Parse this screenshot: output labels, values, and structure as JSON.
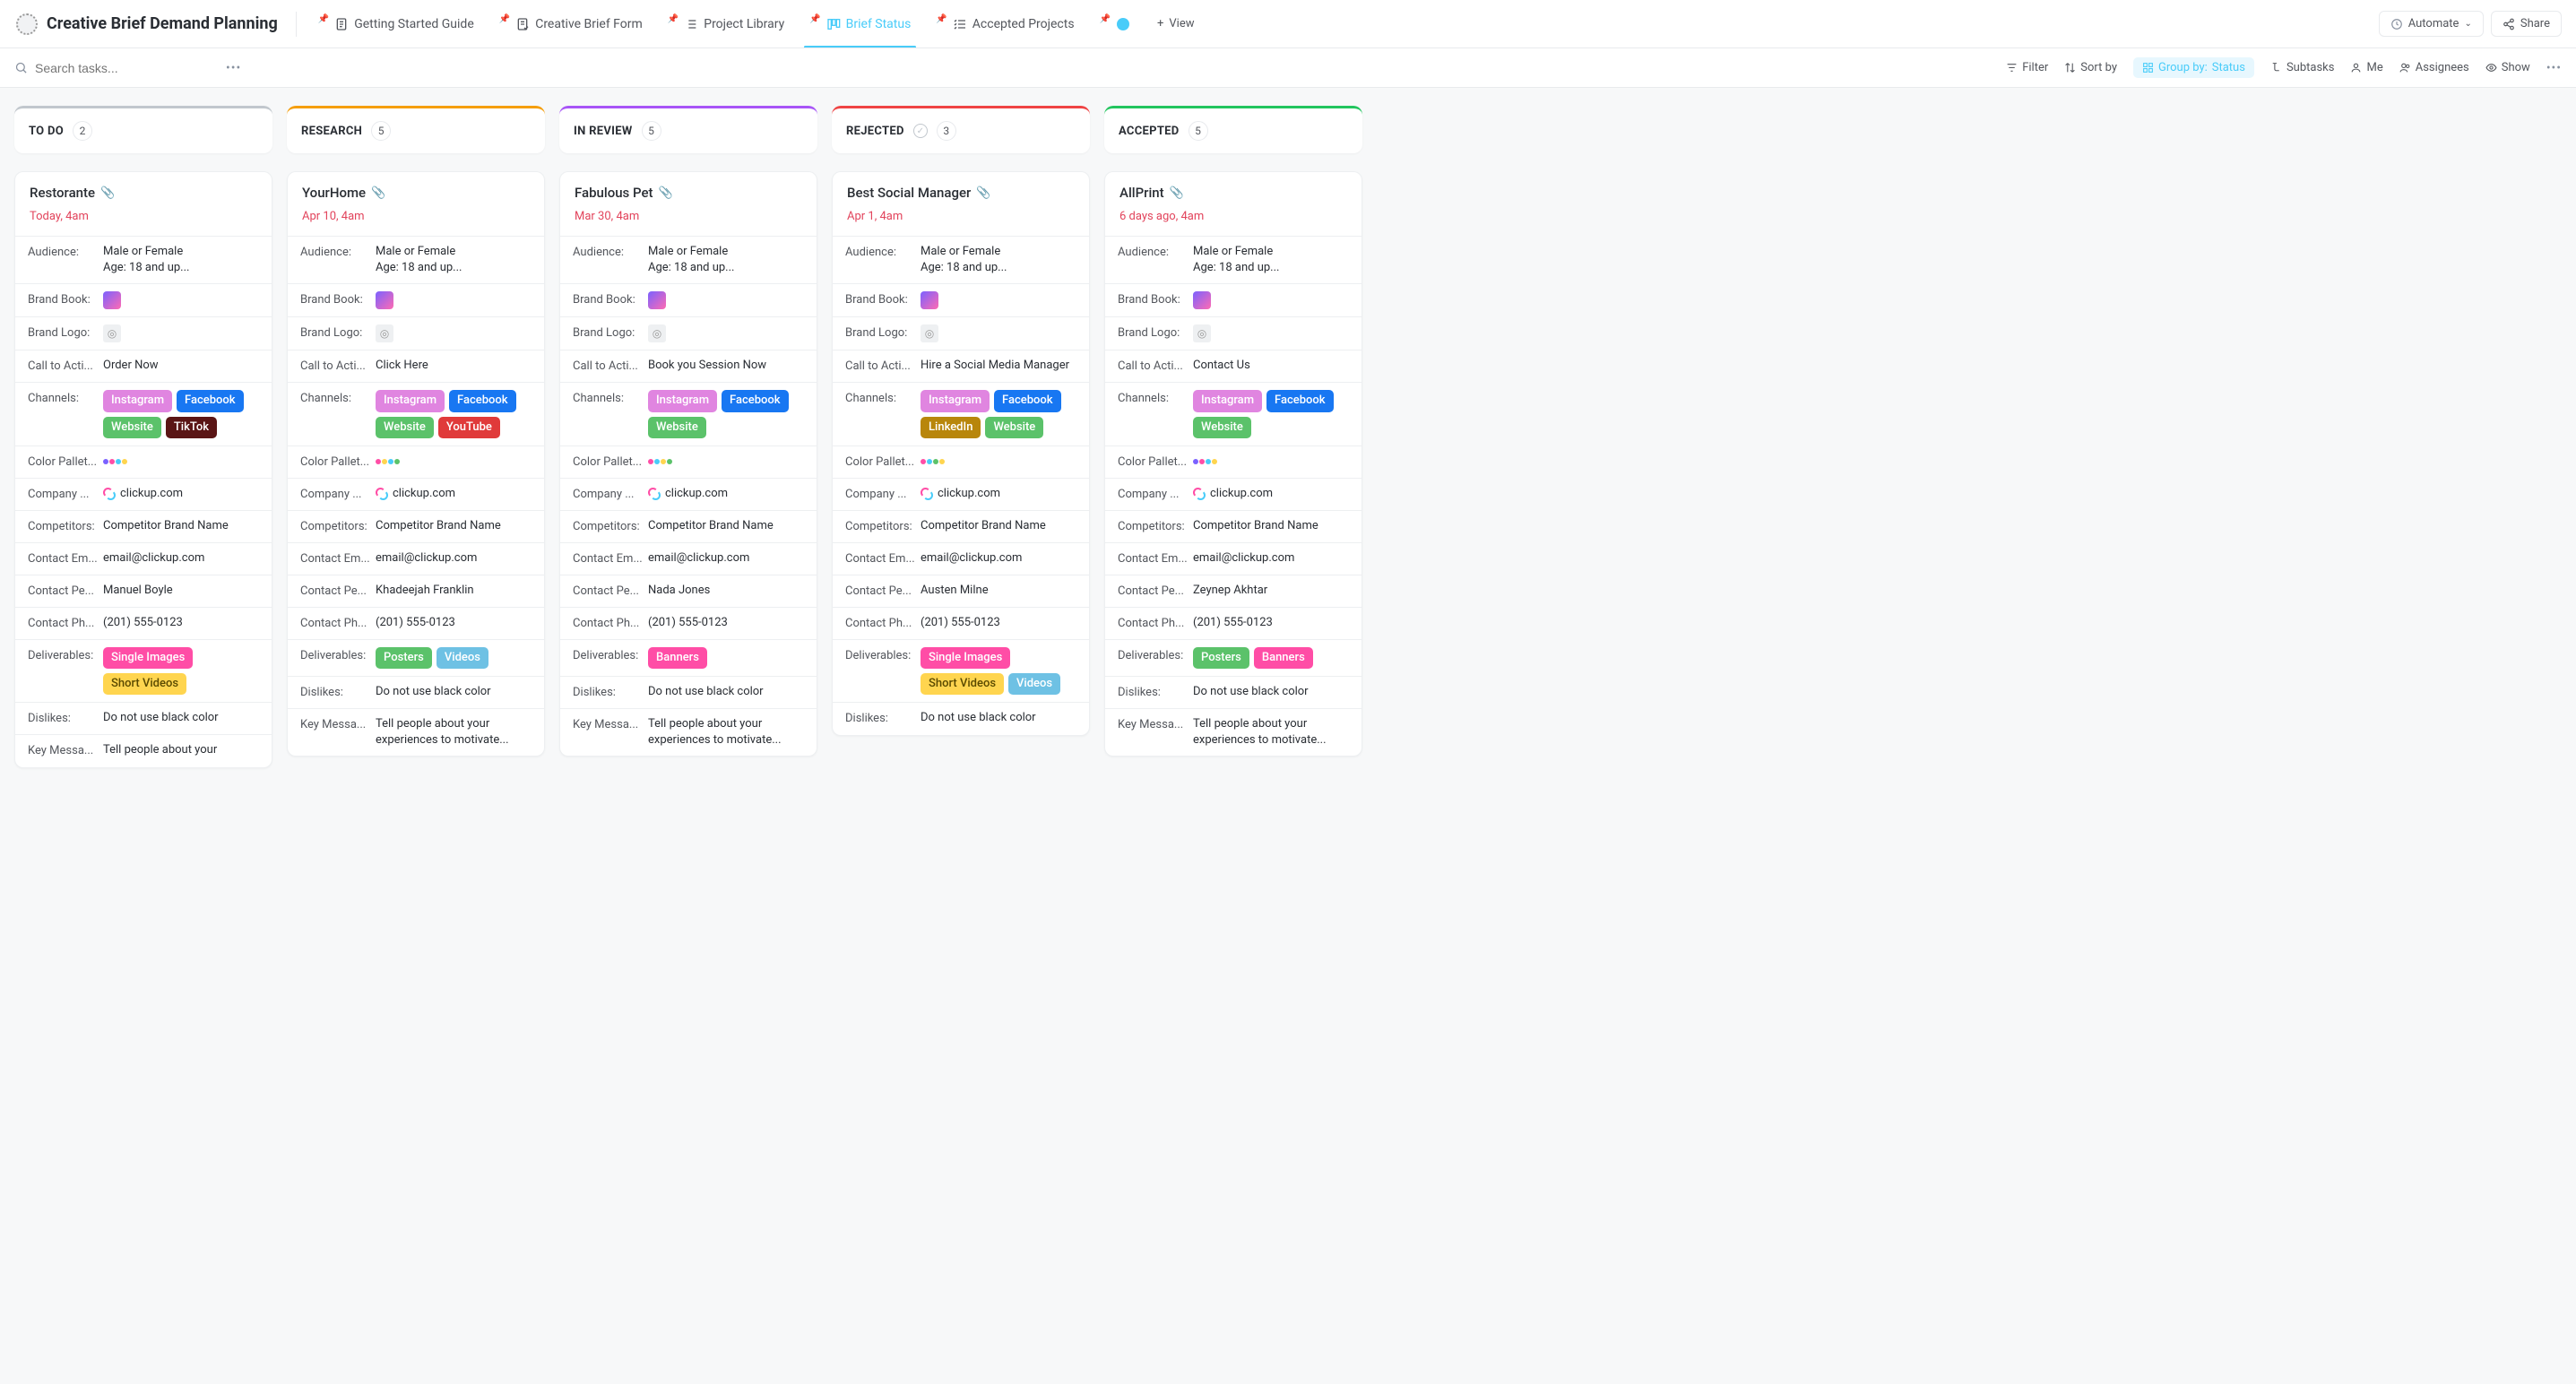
{
  "header": {
    "title": "Creative Brief Demand Planning",
    "tabs": [
      {
        "label": "Getting Started Guide",
        "icon": "doc",
        "active": false
      },
      {
        "label": "Creative Brief Form",
        "icon": "form",
        "active": false
      },
      {
        "label": "Project Library",
        "icon": "list",
        "active": false
      },
      {
        "label": "Brief Status",
        "icon": "board",
        "active": true
      },
      {
        "label": "Accepted Projects",
        "icon": "checklist",
        "active": false
      },
      {
        "label": "",
        "icon": "circle",
        "active": false
      }
    ],
    "add_view": "View",
    "automate": "Automate",
    "share": "Share"
  },
  "toolbar": {
    "search_placeholder": "Search tasks...",
    "filter": "Filter",
    "sort": "Sort by",
    "group_label": "Group by:",
    "group_value": "Status",
    "subtasks": "Subtasks",
    "me": "Me",
    "assignees": "Assignees",
    "show": "Show"
  },
  "columns": [
    {
      "id": "todo",
      "title": "TO DO",
      "count": "2",
      "accent": "col-accent-grey",
      "check": false
    },
    {
      "id": "research",
      "title": "RESEARCH",
      "count": "5",
      "accent": "col-accent-orange",
      "check": false
    },
    {
      "id": "inreview",
      "title": "IN REVIEW",
      "count": "5",
      "accent": "col-accent-purple",
      "check": false
    },
    {
      "id": "rejected",
      "title": "REJECTED",
      "count": "3",
      "accent": "col-accent-red",
      "check": true
    },
    {
      "id": "accepted",
      "title": "ACCEPTED",
      "count": "5",
      "accent": "col-accent-green",
      "check": false
    }
  ],
  "field_labels": {
    "audience": "Audience:",
    "brand_book": "Brand Book:",
    "brand_logo": "Brand Logo:",
    "cta": "Call to Acti...",
    "channels": "Channels:",
    "palette": "Color Pallet...",
    "company": "Company ...",
    "competitors": "Competitors:",
    "email": "Contact Em...",
    "person": "Contact Pe...",
    "phone": "Contact Ph...",
    "deliverables": "Deliverables:",
    "dislikes": "Dislikes:",
    "keymsg": "Key Messa..."
  },
  "shared": {
    "audience": "Male or Female\nAge: 18 and up...",
    "company": "clickup.com",
    "competitors": "Competitor Brand Name",
    "email": "email@clickup.com",
    "phone": "(201) 555-0123",
    "dislikes": "Do not use black color",
    "keymsg_full": "Tell people about your experiences to motivate...",
    "keymsg_partial": "Tell people about your"
  },
  "cards": {
    "todo": {
      "title": "Restorante",
      "date": "Today, 4am",
      "cta": "Order Now",
      "channels": [
        "Instagram",
        "Facebook",
        "Website",
        "TikTok"
      ],
      "person": "Manuel Boyle",
      "deliverables": [
        "Single Images",
        "Short Videos"
      ],
      "palette": [
        "#7b61ff",
        "#ff4da6",
        "#49ccf9",
        "#ffd54f"
      ]
    },
    "research": {
      "title": "YourHome",
      "date": "Apr 10, 4am",
      "cta": "Click Here",
      "channels": [
        "Instagram",
        "Facebook",
        "Website",
        "YouTube"
      ],
      "person": "Khadeejah Franklin",
      "deliverables": [
        "Posters",
        "Videos"
      ],
      "palette": [
        "#ff4da6",
        "#ffd54f",
        "#49ccf9",
        "#5bc26a"
      ]
    },
    "inreview": {
      "title": "Fabulous Pet",
      "date": "Mar 30, 4am",
      "cta": "Book you Session Now",
      "channels": [
        "Instagram",
        "Facebook",
        "Website"
      ],
      "person": "Nada Jones",
      "deliverables": [
        "Banners"
      ],
      "palette": [
        "#ff4da6",
        "#49ccf9",
        "#ffd54f",
        "#5bc26a"
      ]
    },
    "rejected": {
      "title": "Best Social Manager",
      "date": "Apr 1, 4am",
      "cta": "Hire a Social Media Manager",
      "channels": [
        "Instagram",
        "Facebook",
        "LinkedIn",
        "Website"
      ],
      "person": "Austen Milne",
      "deliverables": [
        "Single Images",
        "Short Videos",
        "Videos"
      ],
      "palette": [
        "#ff4da6",
        "#49ccf9",
        "#5bc26a",
        "#ffd54f"
      ]
    },
    "accepted": {
      "title": "AllPrint",
      "date": "6 days ago, 4am",
      "cta": "Contact Us",
      "channels": [
        "Instagram",
        "Facebook",
        "Website"
      ],
      "person": "Zeynep Akhtar",
      "deliverables": [
        "Posters",
        "Banners"
      ],
      "palette": [
        "#7b61ff",
        "#ff4da6",
        "#49ccf9",
        "#ffd54f"
      ]
    }
  },
  "tag_classes": {
    "Instagram": "t-instagram",
    "Facebook": "t-facebook",
    "Website": "t-website",
    "TikTok": "t-tiktok",
    "YouTube": "t-youtube",
    "LinkedIn": "t-linkedin",
    "Single Images": "t-single",
    "Short Videos": "t-shortv",
    "Posters": "t-posters",
    "Videos": "t-videos",
    "Banners": "t-banners"
  }
}
